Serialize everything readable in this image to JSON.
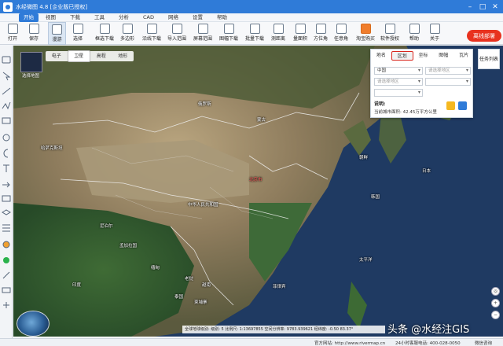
{
  "app": {
    "title": "水经微图 4.8 [企业版已授权]"
  },
  "menu": [
    "开始",
    "视图",
    "下载",
    "工具",
    "分析",
    "CAD",
    "网络",
    "设置",
    "帮助"
  ],
  "toolbar": {
    "items": [
      "打开",
      "保存",
      "漫游",
      "选择",
      "框选下载",
      "多边形",
      "沿线下载",
      "导入范围",
      "屏幕范围",
      "图幅下载",
      "批量下载",
      "测距离",
      "量面积",
      "方位角",
      "任意角",
      "淘宝购买",
      "软件授权",
      "帮助",
      "关于"
    ],
    "offline_label": "离线部署"
  },
  "map": {
    "types": [
      "电子",
      "卫星",
      "高程",
      "地形"
    ],
    "active_type": "卫星",
    "thumbnail_label": "选择地图",
    "task_list_label": "任务列表",
    "labels": [
      "中华人民共和国",
      "北京市",
      "蒙古",
      "日本",
      "朝鲜",
      "韩国",
      "印度",
      "缅甸",
      "越南",
      "泰国",
      "老挝",
      "菲律宾",
      "太平洋",
      "俄罗斯",
      "哈萨克斯坦",
      "尼泊尔",
      "孟加拉国",
      "柬埔寨"
    ]
  },
  "panel": {
    "tabs": [
      "地名",
      "区划",
      "坐标",
      "图幅",
      "瓦片"
    ],
    "active_tab": "区划",
    "country_value": "中国",
    "province_placeholder": "请选择地区",
    "city_placeholder": "请选择地区",
    "note_title": "说明:",
    "area_text": "当前城市面积: 42.45万平方公里"
  },
  "coords": {
    "text": "全球地球级别: 级别: 5  比例尺: 1:13697855  空间分辨率: 9783.939621  经纬度: -0.50  83.37°"
  },
  "watermark": "头条 @水经注GIS",
  "status": {
    "website": "官方网站: http://www.rivermap.cn",
    "hotline": "24小时客服电话: 400-028-0050",
    "wechat": "微信咨询"
  },
  "colors": {
    "title_bar": "#2f7bd8",
    "offline_button": "#e8321f",
    "active_tab_border": "#d8261d"
  }
}
